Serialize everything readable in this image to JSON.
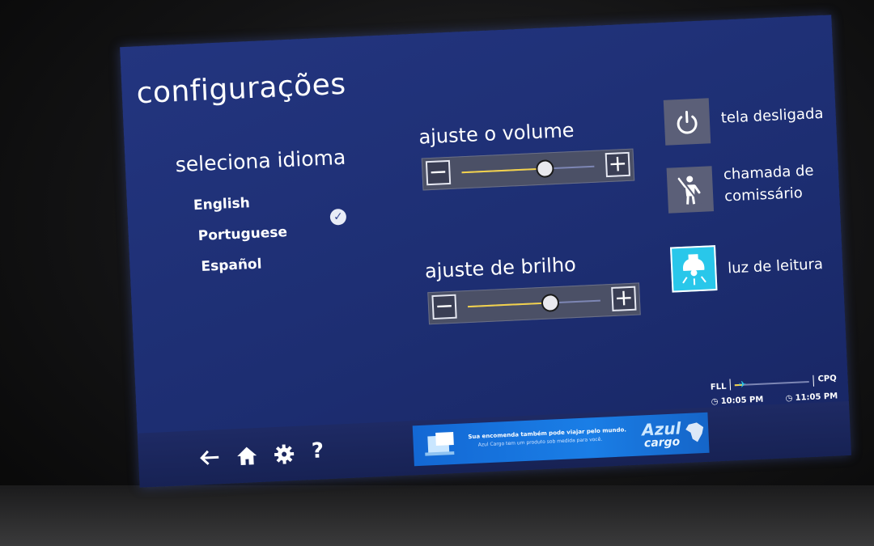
{
  "screen": {
    "title": "configurações"
  },
  "language": {
    "heading": "seleciona idioma",
    "options": [
      {
        "label": "English"
      },
      {
        "label": "Portuguese",
        "selected": true
      },
      {
        "label": "Español"
      }
    ]
  },
  "volume": {
    "heading": "ajuste o volume",
    "minus_label": "−",
    "plus_label": "+",
    "level": 0.63
  },
  "brightness": {
    "heading": "ajuste de brilho",
    "minus_label": "−",
    "plus_label": "+",
    "level": 0.62
  },
  "actions": {
    "screen_off": {
      "label": "tela desligada",
      "icon": "power-icon"
    },
    "call_attendant": {
      "label_line1": "chamada de",
      "label_line2": "comissário",
      "icon": "flight-attendant-icon"
    },
    "reading_light": {
      "label": "luz de leitura",
      "icon": "reading-light-icon",
      "active": true
    }
  },
  "flight": {
    "origin": "FLL",
    "destination": "CPQ",
    "departure_time": "10:05 PM",
    "arrival_time": "11:05 PM",
    "progress": 0.12
  },
  "ad": {
    "line1": "Sua encomenda também pode viajar pelo mundo.",
    "line2": "Azul Cargo tem um produto sob medida para você.",
    "brand_line1": "Azul",
    "brand_line2": "cargo"
  },
  "nav": {
    "back_icon": "back-arrow-icon",
    "home_icon": "home-icon",
    "settings_icon": "gear-icon",
    "help_label": "?"
  },
  "colors": {
    "background": "#1f307a",
    "accent_yellow": "#f2d14a",
    "active_tile": "#29c7ea"
  }
}
